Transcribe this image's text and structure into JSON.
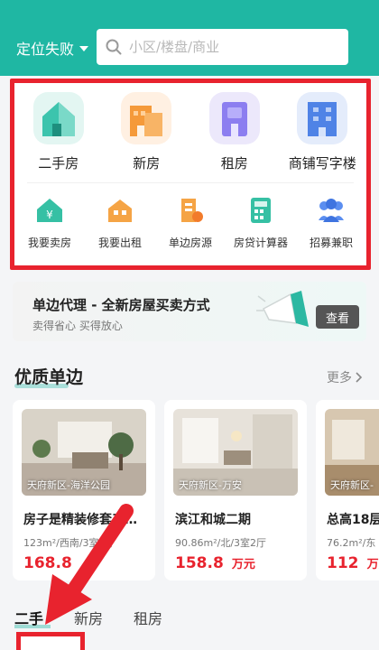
{
  "header": {
    "location": "定位失败",
    "search_placeholder": "小区/楼盘/商业"
  },
  "categories_main": [
    {
      "label": "二手房",
      "icon": "house-icon"
    },
    {
      "label": "新房",
      "icon": "building-icon"
    },
    {
      "label": "租房",
      "icon": "rent-icon"
    },
    {
      "label": "商铺写字楼",
      "icon": "office-icon"
    }
  ],
  "categories_sub": [
    {
      "label": "我要卖房",
      "icon": "sell-house-icon"
    },
    {
      "label": "我要出租",
      "icon": "rent-out-icon"
    },
    {
      "label": "单边房源",
      "icon": "listing-icon"
    },
    {
      "label": "房贷计算器",
      "icon": "calculator-icon"
    },
    {
      "label": "招募兼职",
      "icon": "recruit-icon"
    }
  ],
  "banner": {
    "title": "单边代理 - 全新房屋买卖方式",
    "subtitle": "卖得省心 买得放心",
    "button": "查看"
  },
  "section": {
    "title": "优质单边",
    "more": "更多"
  },
  "cards": [
    {
      "location": "天府新区-海洋公园",
      "title": "房子是精装修套三…",
      "meta": "123m²/西南/3室2厅",
      "price": "168.8",
      "unit": "万元"
    },
    {
      "location": "天府新区-万安",
      "title": "滨江和城二期",
      "meta": "90.86m²/北/3室2厅",
      "price": "158.8",
      "unit": "万元"
    },
    {
      "location": "天府新区-",
      "title": "总高18层",
      "meta": "76.2m²/东",
      "price": "112",
      "unit": "万元"
    }
  ],
  "tabs": [
    "二手",
    "新房",
    "租房"
  ],
  "colors": {
    "accent": "#1fb7a3",
    "price": "#e8232e",
    "highlight": "#e8232e"
  }
}
